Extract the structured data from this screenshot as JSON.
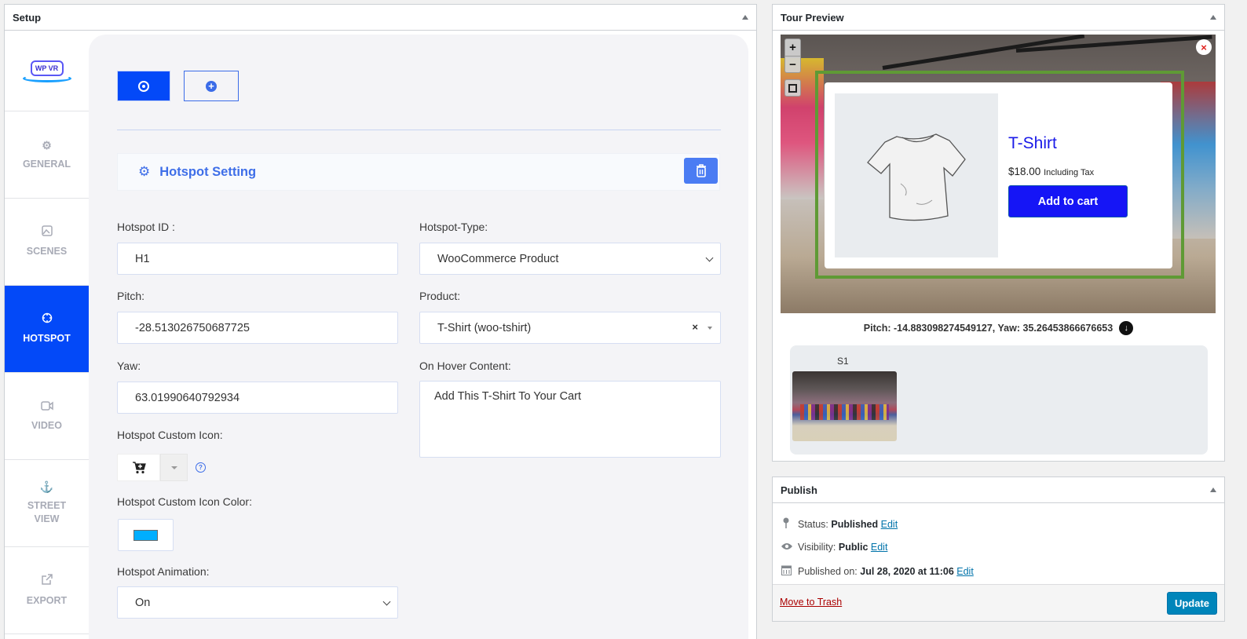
{
  "setup": {
    "title": "Setup",
    "logo_text": "WP VR",
    "nav": [
      {
        "label": "GENERAL",
        "icon": "gear-icon"
      },
      {
        "label": "SCENES",
        "icon": "image-icon"
      },
      {
        "label": "HOTSPOT",
        "icon": "crosshair-icon",
        "active": true
      },
      {
        "label": "VIDEO",
        "icon": "video-icon"
      },
      {
        "label": "STREET VIEW",
        "icon": "anchor-icon"
      },
      {
        "label": "EXPORT",
        "icon": "external-link-icon"
      }
    ],
    "tabs": [
      {
        "name": "hotspot-1",
        "icon": "target-icon",
        "active": true
      },
      {
        "name": "add-hotspot",
        "icon": "plus-circle-icon",
        "active": false
      }
    ],
    "hotspot_setting": {
      "title": "Hotspot Setting",
      "delete_icon": "trash-icon"
    },
    "fields": {
      "hotspot_id": {
        "label": "Hotspot ID :",
        "value": "H1"
      },
      "pitch": {
        "label": "Pitch:",
        "value": "-28.513026750687725"
      },
      "yaw": {
        "label": "Yaw:",
        "value": "63.01990640792934"
      },
      "custom_icon": {
        "label": "Hotspot Custom Icon:",
        "value": "cart-plus-icon",
        "help": "?"
      },
      "custom_icon_color": {
        "label": "Hotspot Custom Icon Color:",
        "value": "#00aeff"
      },
      "animation": {
        "label": "Hotspot Animation:",
        "value": "On"
      },
      "hotspot_type": {
        "label": "Hotspot-Type:",
        "value": "WooCommerce Product"
      },
      "product": {
        "label": "Product:",
        "value": "T-Shirt (woo-tshirt)",
        "clear": "×"
      },
      "hover_content": {
        "label": "On Hover Content:",
        "value": "Add This T-Shirt To Your Cart"
      }
    }
  },
  "preview": {
    "title": "Tour Preview",
    "zoom_in": "+",
    "zoom_out": "−",
    "close": "×",
    "popup": {
      "product_name": "T-Shirt",
      "price": "$18.00",
      "price_suffix": "Including Tax",
      "button": "Add to cart"
    },
    "coords_text": "Pitch: -14.883098274549127, Yaw: 35.26453866676653",
    "scenes": [
      {
        "label": "S1"
      }
    ]
  },
  "publish": {
    "title": "Publish",
    "status_label": "Status:",
    "status_value": "Published",
    "visibility_label": "Visibility:",
    "visibility_value": "Public",
    "published_label": "Published on:",
    "published_value": "Jul 28, 2020 at 11:06",
    "edit": "Edit",
    "trash": "Move to Trash",
    "update": "Update"
  },
  "colors": {
    "accent": "#0349f8",
    "link": "#0073aa",
    "popup_title": "#1a1ae8",
    "cart_button": "#1515f6",
    "frame": "#5f9a35",
    "update_button": "#0085ba"
  }
}
